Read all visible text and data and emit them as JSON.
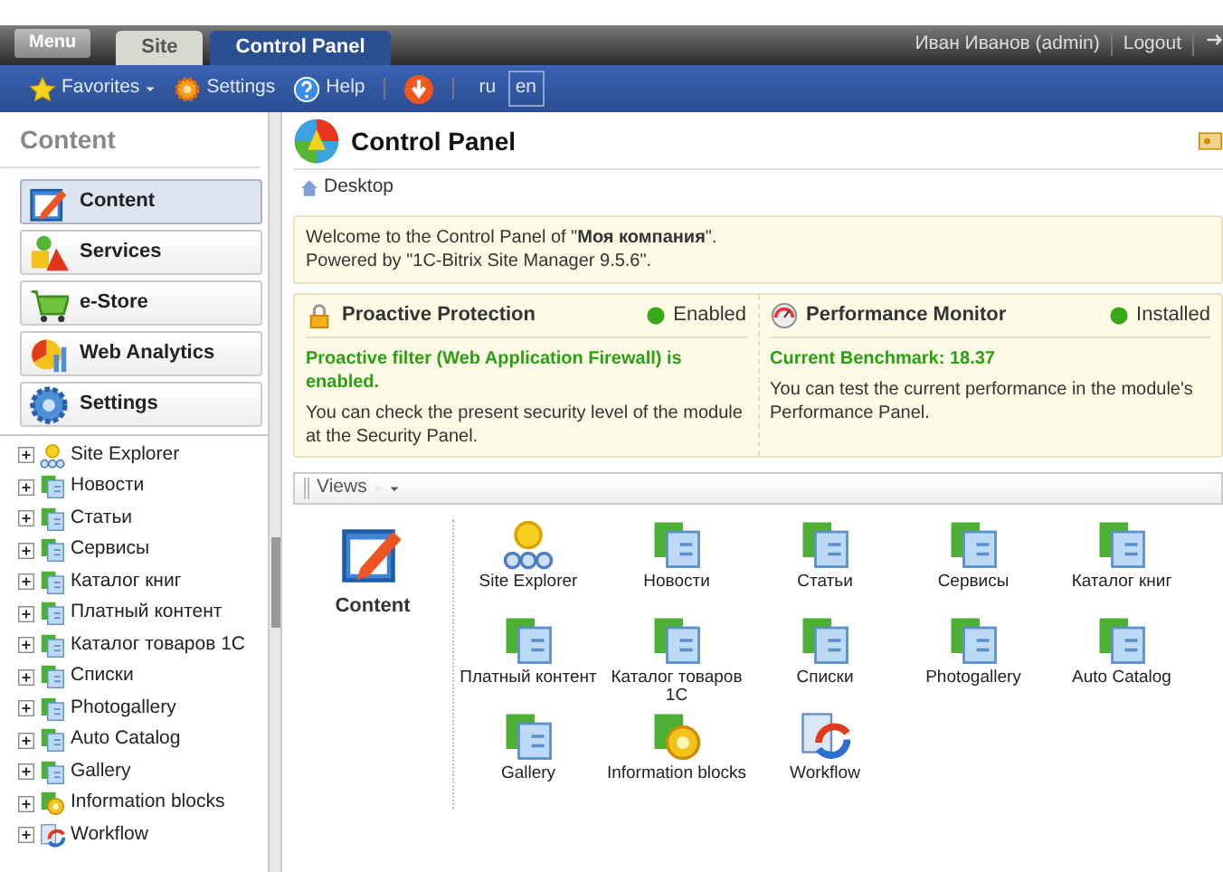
{
  "top_bar": {
    "menu": "Menu",
    "tabs": [
      {
        "label": "Site",
        "selected": false
      },
      {
        "label": "Control Panel",
        "selected": true
      }
    ],
    "user": "Иван Иванов (admin)",
    "logout": "Logout"
  },
  "toolbar": {
    "favorites": "Favorites",
    "settings": "Settings",
    "help": "Help",
    "languages": [
      {
        "label": "ru",
        "selected": false
      },
      {
        "label": "en",
        "selected": true
      }
    ]
  },
  "sidebar": {
    "title": "Content",
    "modules": [
      {
        "label": "Content",
        "kind": "content",
        "selected": true
      },
      {
        "label": "Services",
        "kind": "services",
        "selected": false
      },
      {
        "label": "e-Store",
        "kind": "store",
        "selected": false
      },
      {
        "label": "Web Analytics",
        "kind": "analytics",
        "selected": false
      },
      {
        "label": "Settings",
        "kind": "settings",
        "selected": false
      }
    ],
    "tree": [
      {
        "label": "Site Explorer",
        "kind": "explorer",
        "expanded": false
      },
      {
        "label": "Новости",
        "kind": "iblock",
        "expanded": false
      },
      {
        "label": "Статьи",
        "kind": "iblock",
        "expanded": false
      },
      {
        "label": "Сервисы",
        "kind": "iblock",
        "expanded": false
      },
      {
        "label": "Каталог книг",
        "kind": "iblock",
        "expanded": false
      },
      {
        "label": "Платный контент",
        "kind": "iblock",
        "expanded": false
      },
      {
        "label": "Каталог товаров 1С",
        "kind": "iblock",
        "expanded": false
      },
      {
        "label": "Списки",
        "kind": "iblock",
        "expanded": false
      },
      {
        "label": "Photogallery",
        "kind": "iblock",
        "expanded": false
      },
      {
        "label": "Auto Catalog",
        "kind": "iblock",
        "expanded": false
      },
      {
        "label": "Gallery",
        "kind": "iblock",
        "expanded": false
      },
      {
        "label": "Information blocks",
        "kind": "iblocks",
        "expanded": false
      },
      {
        "label": "Workflow",
        "kind": "workflow",
        "expanded": false
      }
    ]
  },
  "main": {
    "title": "Control Panel",
    "breadcrumb": "Desktop",
    "welcome": [
      "Welcome to the Control Panel of \"**Моя компания**\".",
      "Powered by \"1C-Bitrix Site Manager 9.5.6\"."
    ],
    "gadgets": [
      {
        "kind": "lock",
        "title": "Proactive Protection",
        "status": "Enabled",
        "headline": "Proactive filter (Web Application Firewall) is enabled.",
        "text": "You can check the present security level of the module at the ",
        "link": "Security Panel",
        "after": "."
      },
      {
        "kind": "gauge",
        "title": "Performance Monitor",
        "status": "Installed",
        "headline": "Current Benchmark: 18.37",
        "text": "You can test the current performance in the module's ",
        "link": "Performance Panel",
        "after": "."
      }
    ],
    "views": "Views",
    "section": "Content",
    "items": [
      {
        "label": "Site Explorer",
        "kind": "explorer"
      },
      {
        "label": "Новости",
        "kind": "iblock"
      },
      {
        "label": "Статьи",
        "kind": "iblock"
      },
      {
        "label": "Сервисы",
        "kind": "iblock"
      },
      {
        "label": "Каталог книг",
        "kind": "iblock"
      },
      {
        "label": "Платный контент",
        "kind": "iblock"
      },
      {
        "label": "Каталог товаров 1С",
        "kind": "iblock"
      },
      {
        "label": "Списки",
        "kind": "iblock"
      },
      {
        "label": "Photogallery",
        "kind": "iblock"
      },
      {
        "label": "Auto Catalog",
        "kind": "iblock"
      },
      {
        "label": "Gallery",
        "kind": "iblock"
      },
      {
        "label": "Information blocks",
        "kind": "iblocks"
      },
      {
        "label": "Workflow",
        "kind": "workflow"
      }
    ]
  }
}
